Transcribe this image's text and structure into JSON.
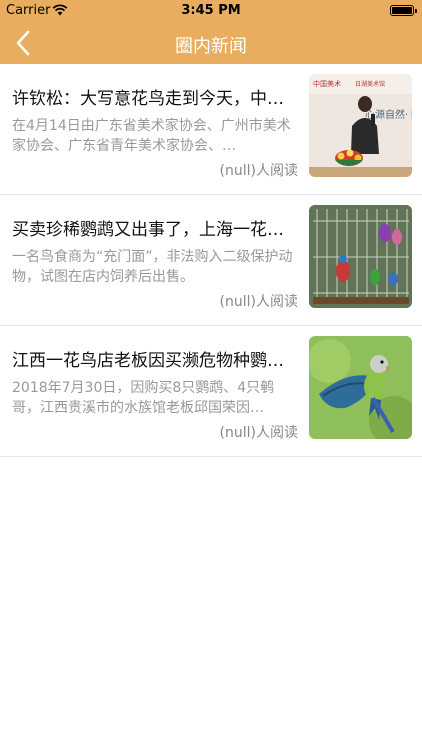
{
  "status_bar": {
    "carrier": "Carrier",
    "time": "3:45 PM"
  },
  "nav": {
    "title": "圈内新闻",
    "back_icon": "chevron-left-icon"
  },
  "news": [
    {
      "title": "许钦松：大写意花鸟走到今天，中…",
      "summary": "在4月14日由广东省美术家协会、广州市美术家协会、广东省青年美术家协会、…",
      "reads": "(null)人阅读",
      "thumb_texts": [
        "中国美术",
        "日湖美术馆",
        "心源自然·卜"
      ]
    },
    {
      "title": "买卖珍稀鹦鹉又出事了，上海一花…",
      "summary": "一名鸟食商为“充门面”，非法购入二级保护动物，试图在店内饲养后出售。",
      "reads": "(null)人阅读"
    },
    {
      "title": "江西一花鸟店老板因买濒危物种鹦…",
      "summary": "2018年7月30日，因购买8只鹦鹉、4只鹌哥，江西贵溪市的水族馆老板邱国荣因…",
      "reads": "(null)人阅读"
    }
  ],
  "colors": {
    "nav_bar": "#e9ad5f",
    "divider": "#e6e6e6",
    "summary_text": "#999999"
  }
}
